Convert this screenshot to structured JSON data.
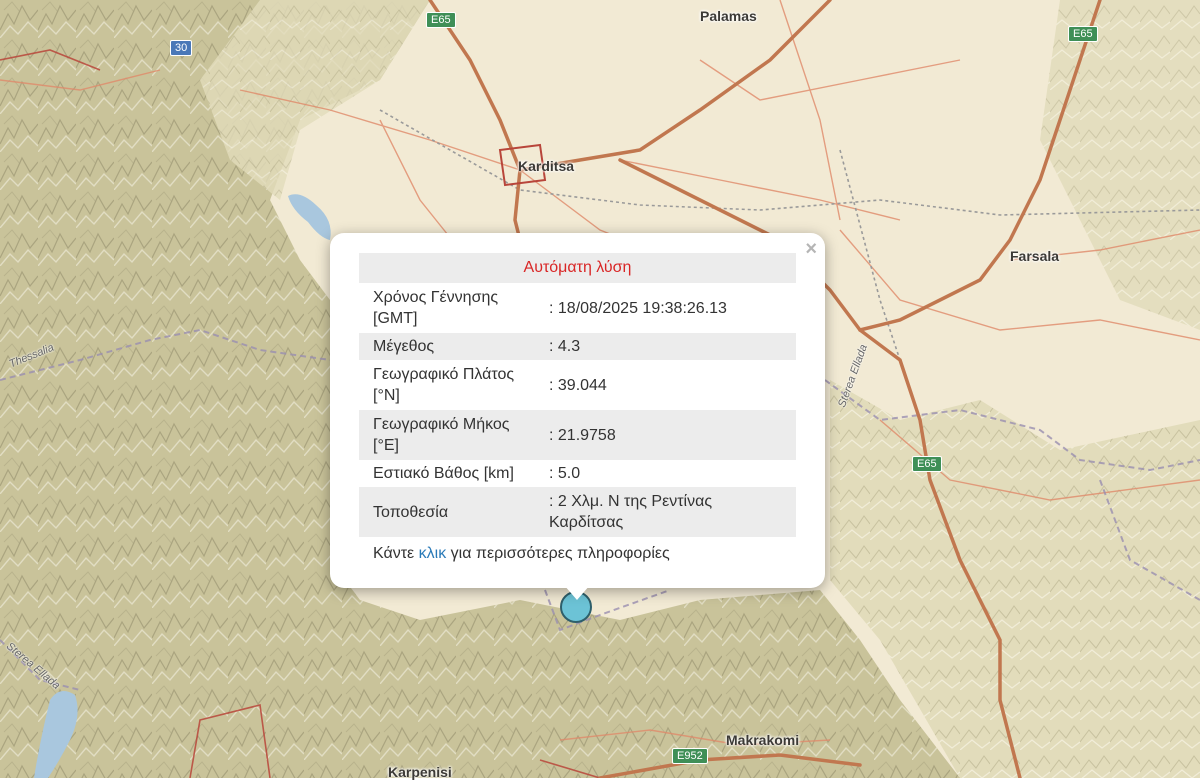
{
  "map": {
    "places": [
      {
        "name": "Palamas",
        "key": "palamas"
      },
      {
        "name": "Karditsa",
        "key": "karditsa"
      },
      {
        "name": "Farsala",
        "key": "farsala"
      },
      {
        "name": "Makrakomi",
        "key": "makrakomi"
      },
      {
        "name": "Karpenisi",
        "key": "karpenisi"
      }
    ],
    "road_shields": [
      "E65",
      "E65",
      "30",
      "E65",
      "E952"
    ],
    "road_labels": [
      "Thessalia",
      "Sterea Ellada",
      "Sterea Ellada"
    ],
    "marker_icon": "earthquake-epicenter-icon",
    "marker_color": "#6cc3d6"
  },
  "popup": {
    "title": "Αυτόματη λύση",
    "close_symbol": "×",
    "rows": [
      {
        "label": "Χρόνος Γέννησης [GMT]",
        "value": ": 18/08/2025 19:38:26.13"
      },
      {
        "label": "Μέγεθος",
        "value": ": 4.3"
      },
      {
        "label": "Γεωγραφικό Πλάτος [°N]",
        "value": ": 39.044"
      },
      {
        "label": "Γεωγραφικό Μήκος [°E]",
        "value": ": 21.9758"
      },
      {
        "label": "Εστιακό Βάθος [km]",
        "value": ": 5.0"
      },
      {
        "label": "Τοποθεσία",
        "value": ": 2 Χλμ. Ν της Ρεντίνας Καρδίτσας"
      }
    ],
    "footer_prefix": "Κάντε",
    "footer_link": "κλικ",
    "footer_suffix": "για περισσότερες πληροφορίες",
    "title_color": "#d92626",
    "link_color": "#2a7ab8"
  }
}
